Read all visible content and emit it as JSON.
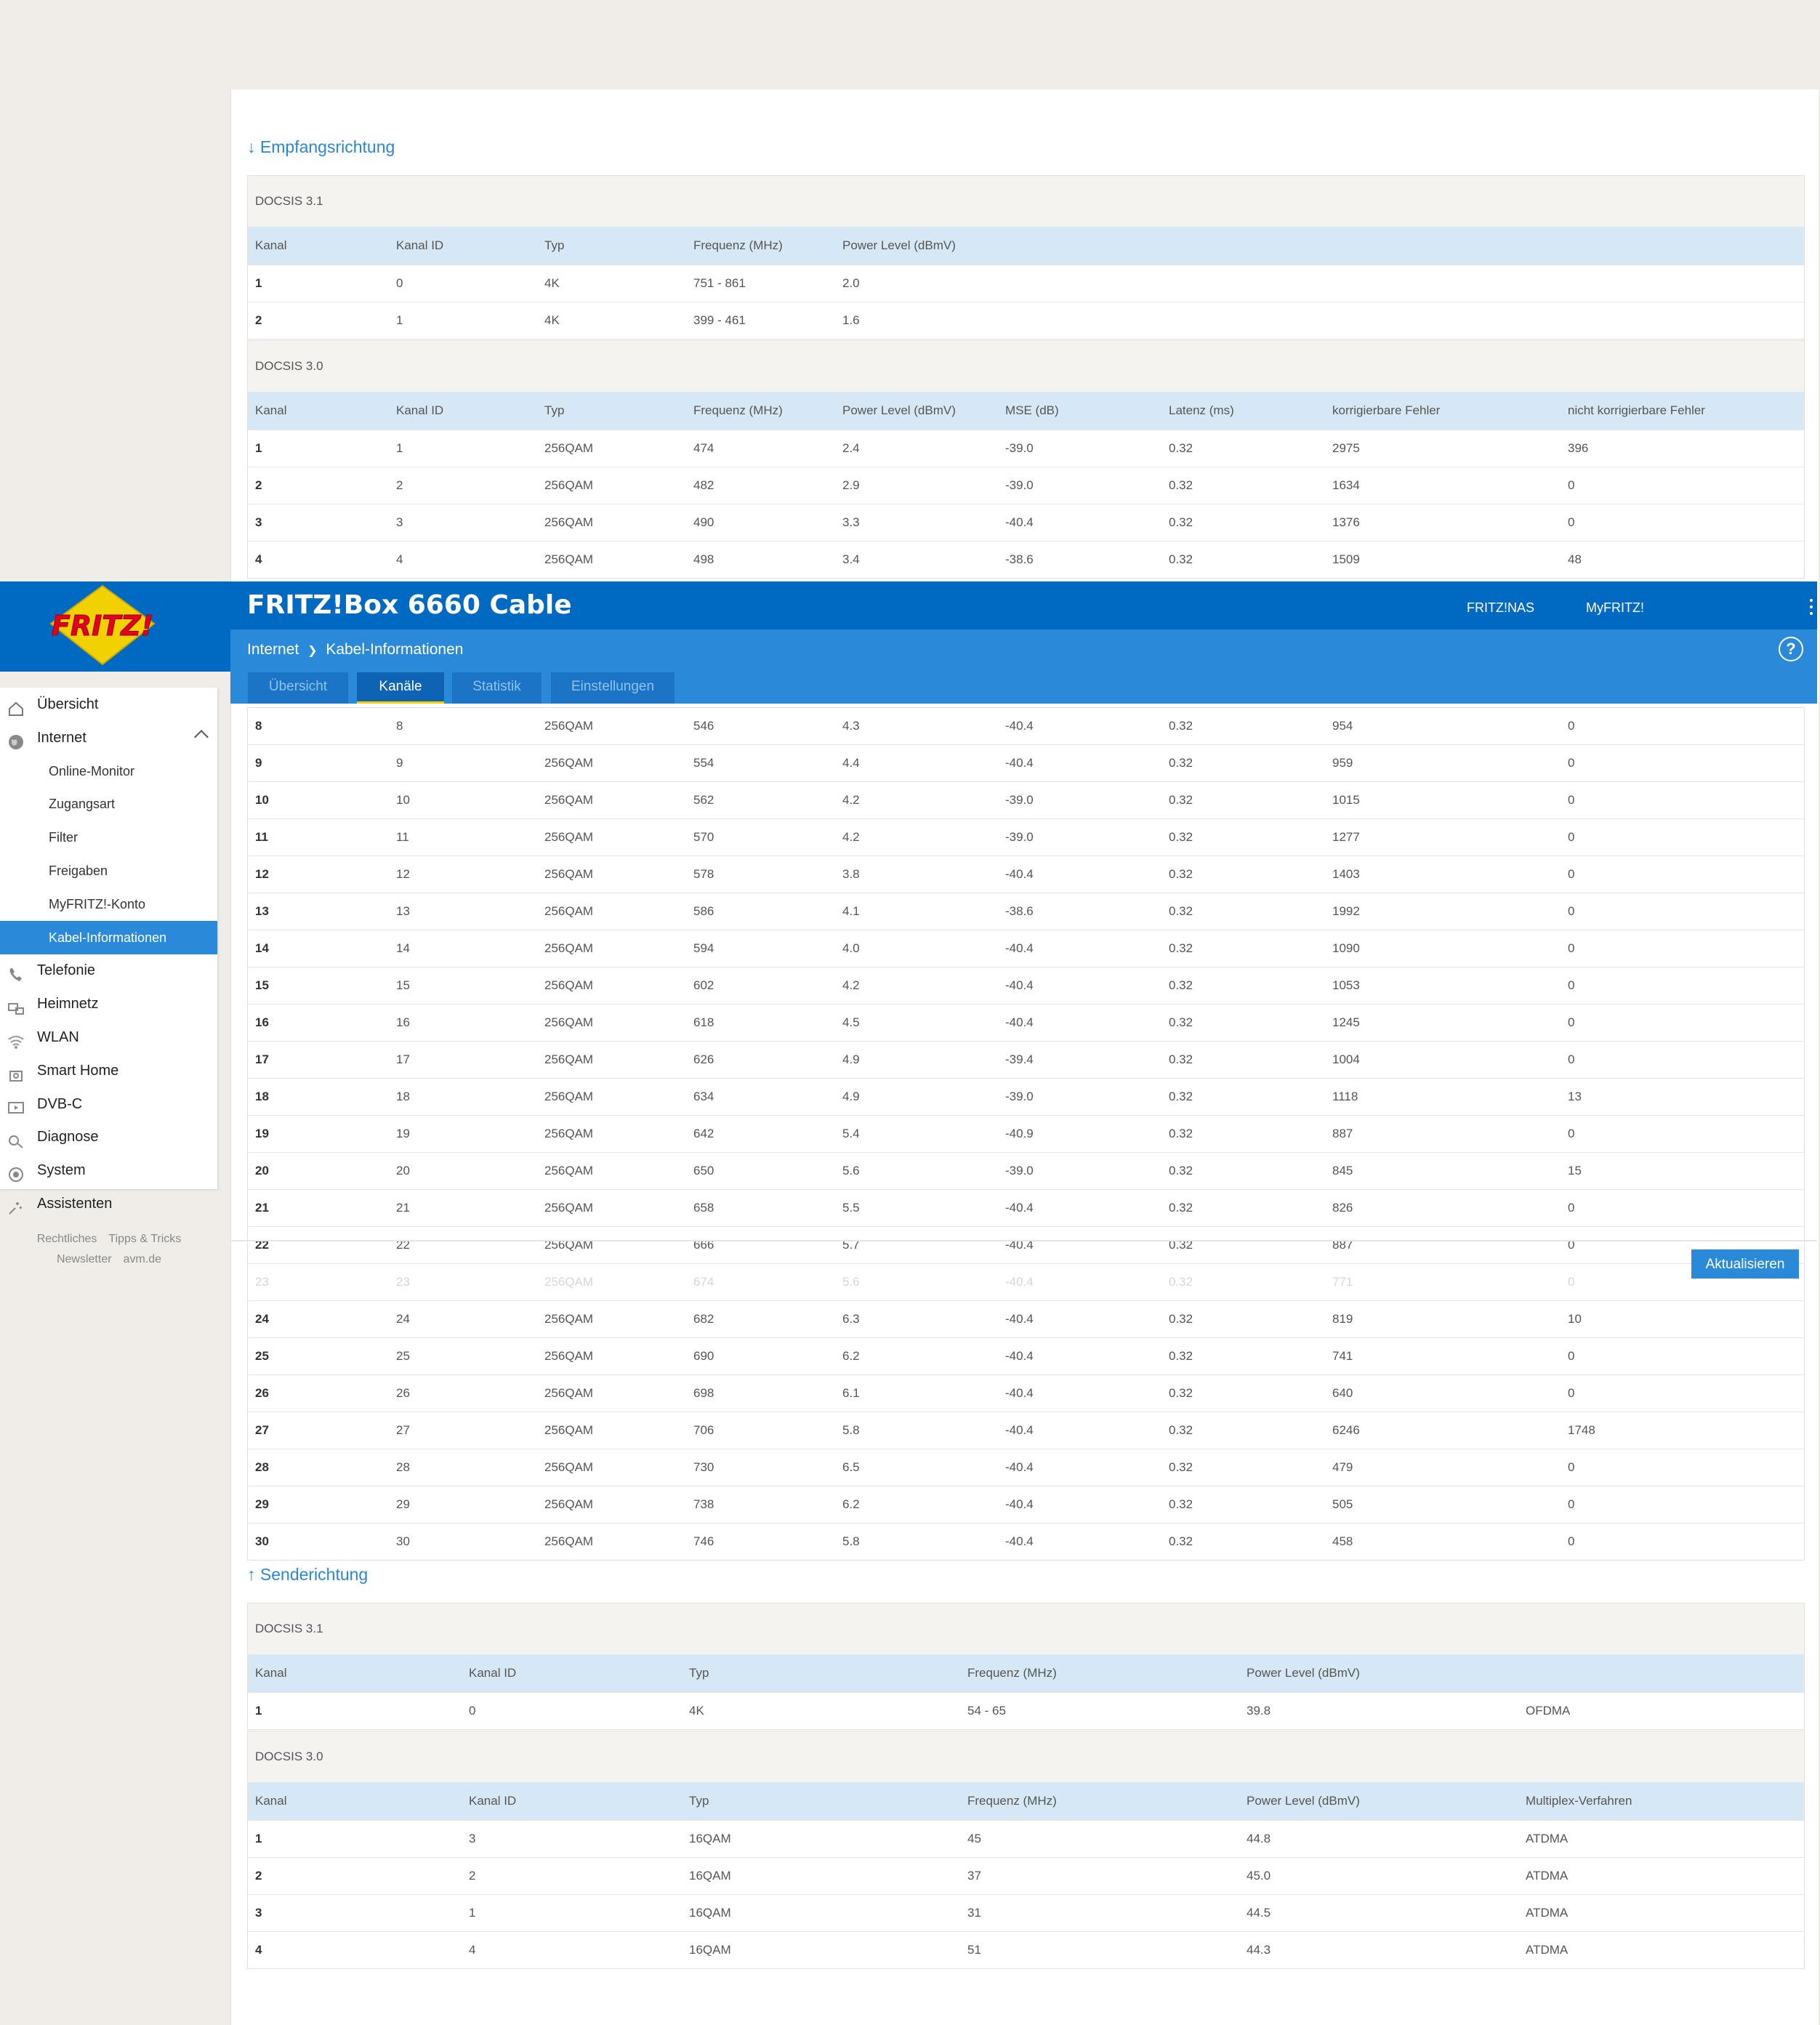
{
  "app": {
    "title": "FRITZ!Box 6660 Cable",
    "links": [
      "FRITZ!NAS",
      "MyFRITZ!"
    ],
    "logo_text": "FRITZ!"
  },
  "breadcrumb": {
    "parent": "Internet",
    "separator": "❯",
    "current": "Kabel-Informationen"
  },
  "help_label": "?",
  "tabs": [
    "Übersicht",
    "Kanäle",
    "Statistik",
    "Einstellungen"
  ],
  "active_tab": "Kanäle",
  "sidebar": {
    "items": [
      {
        "label": "Übersicht",
        "icon": "home-icon"
      },
      {
        "label": "Internet",
        "icon": "globe-icon",
        "expanded": true
      },
      {
        "label": "Online-Monitor",
        "sub": true
      },
      {
        "label": "Zugangsart",
        "sub": true
      },
      {
        "label": "Filter",
        "sub": true
      },
      {
        "label": "Freigaben",
        "sub": true
      },
      {
        "label": "MyFRITZ!-Konto",
        "sub": true
      },
      {
        "label": "Kabel-Informationen",
        "sub": true,
        "active": true
      },
      {
        "label": "Telefonie",
        "icon": "phone-icon"
      },
      {
        "label": "Heimnetz",
        "icon": "network-icon"
      },
      {
        "label": "WLAN",
        "icon": "wifi-icon"
      },
      {
        "label": "Smart Home",
        "icon": "smarthome-icon"
      },
      {
        "label": "DVB-C",
        "icon": "tv-icon"
      },
      {
        "label": "Diagnose",
        "icon": "diagnose-icon"
      },
      {
        "label": "System",
        "icon": "system-icon"
      },
      {
        "label": "Assistenten",
        "icon": "wizard-icon"
      }
    ],
    "footer_links": [
      [
        "Rechtliches",
        "Tipps & Tricks"
      ],
      [
        "Newsletter",
        "avm.de"
      ]
    ]
  },
  "refresh_label": "Aktualisieren",
  "downstream": {
    "title": "↓ Empfangsrichtung",
    "docsis31": {
      "label": "DOCSIS 3.1",
      "columns": [
        "Kanal",
        "Kanal ID",
        "Typ",
        "Frequenz (MHz)",
        "Power Level (dBmV)"
      ],
      "rows": [
        [
          "1",
          "0",
          "4K",
          "751 - 861",
          "2.0"
        ],
        [
          "2",
          "1",
          "4K",
          "399 - 461",
          "1.6"
        ]
      ]
    },
    "docsis30": {
      "label": "DOCSIS 3.0",
      "columns": [
        "Kanal",
        "Kanal ID",
        "Typ",
        "Frequenz (MHz)",
        "Power Level (dBmV)",
        "MSE (dB)",
        "Latenz (ms)",
        "korrigierbare Fehler",
        "nicht korrigierbare Fehler"
      ],
      "rows_top": [
        [
          "1",
          "1",
          "256QAM",
          "474",
          "2.4",
          "-39.0",
          "0.32",
          "2975",
          "396"
        ],
        [
          "2",
          "2",
          "256QAM",
          "482",
          "2.9",
          "-39.0",
          "0.32",
          "1634",
          "0"
        ],
        [
          "3",
          "3",
          "256QAM",
          "490",
          "3.3",
          "-40.4",
          "0.32",
          "1376",
          "0"
        ],
        [
          "4",
          "4",
          "256QAM",
          "498",
          "3.4",
          "-38.6",
          "0.32",
          "1509",
          "48"
        ]
      ],
      "rows_bottom": [
        [
          "8",
          "8",
          "256QAM",
          "546",
          "4.3",
          "-40.4",
          "0.32",
          "954",
          "0"
        ],
        [
          "9",
          "9",
          "256QAM",
          "554",
          "4.4",
          "-40.4",
          "0.32",
          "959",
          "0"
        ],
        [
          "10",
          "10",
          "256QAM",
          "562",
          "4.2",
          "-39.0",
          "0.32",
          "1015",
          "0"
        ],
        [
          "11",
          "11",
          "256QAM",
          "570",
          "4.2",
          "-39.0",
          "0.32",
          "1277",
          "0"
        ],
        [
          "12",
          "12",
          "256QAM",
          "578",
          "3.8",
          "-40.4",
          "0.32",
          "1403",
          "0"
        ],
        [
          "13",
          "13",
          "256QAM",
          "586",
          "4.1",
          "-38.6",
          "0.32",
          "1992",
          "0"
        ],
        [
          "14",
          "14",
          "256QAM",
          "594",
          "4.0",
          "-40.4",
          "0.32",
          "1090",
          "0"
        ],
        [
          "15",
          "15",
          "256QAM",
          "602",
          "4.2",
          "-40.4",
          "0.32",
          "1053",
          "0"
        ],
        [
          "16",
          "16",
          "256QAM",
          "618",
          "4.5",
          "-40.4",
          "0.32",
          "1245",
          "0"
        ],
        [
          "17",
          "17",
          "256QAM",
          "626",
          "4.9",
          "-39.4",
          "0.32",
          "1004",
          "0"
        ],
        [
          "18",
          "18",
          "256QAM",
          "634",
          "4.9",
          "-39.0",
          "0.32",
          "1118",
          "13"
        ],
        [
          "19",
          "19",
          "256QAM",
          "642",
          "5.4",
          "-40.9",
          "0.32",
          "887",
          "0"
        ],
        [
          "20",
          "20",
          "256QAM",
          "650",
          "5.6",
          "-39.0",
          "0.32",
          "845",
          "15"
        ],
        [
          "21",
          "21",
          "256QAM",
          "658",
          "5.5",
          "-40.4",
          "0.32",
          "826",
          "0"
        ],
        [
          "22",
          "22",
          "256QAM",
          "666",
          "5.7",
          "-40.4",
          "0.32",
          "887",
          "0"
        ],
        [
          "23",
          "23",
          "256QAM",
          "674",
          "5.6",
          "-40.4",
          "0.32",
          "771",
          "0"
        ],
        [
          "24",
          "24",
          "256QAM",
          "682",
          "6.3",
          "-40.4",
          "0.32",
          "819",
          "10"
        ],
        [
          "25",
          "25",
          "256QAM",
          "690",
          "6.2",
          "-40.4",
          "0.32",
          "741",
          "0"
        ],
        [
          "26",
          "26",
          "256QAM",
          "698",
          "6.1",
          "-40.4",
          "0.32",
          "640",
          "0"
        ],
        [
          "27",
          "27",
          "256QAM",
          "706",
          "5.8",
          "-40.4",
          "0.32",
          "6246",
          "1748"
        ],
        [
          "28",
          "28",
          "256QAM",
          "730",
          "6.5",
          "-40.4",
          "0.32",
          "479",
          "0"
        ],
        [
          "29",
          "29",
          "256QAM",
          "738",
          "6.2",
          "-40.4",
          "0.32",
          "505",
          "0"
        ],
        [
          "30",
          "30",
          "256QAM",
          "746",
          "5.8",
          "-40.4",
          "0.32",
          "458",
          "0"
        ]
      ]
    }
  },
  "upstream": {
    "title": "↑ Senderichtung",
    "docsis31": {
      "label": "DOCSIS 3.1",
      "columns": [
        "Kanal",
        "Kanal ID",
        "Typ",
        "Frequenz (MHz)",
        "Power Level (dBmV)",
        ""
      ],
      "rows": [
        [
          "1",
          "0",
          "4K",
          "54 - 65",
          "39.8",
          "OFDMA"
        ]
      ]
    },
    "docsis30": {
      "label": "DOCSIS 3.0",
      "columns": [
        "Kanal",
        "Kanal ID",
        "Typ",
        "Frequenz (MHz)",
        "Power Level (dBmV)",
        "Multiplex-Verfahren"
      ],
      "rows": [
        [
          "1",
          "3",
          "16QAM",
          "45",
          "44.8",
          "ATDMA"
        ],
        [
          "2",
          "2",
          "16QAM",
          "37",
          "45.0",
          "ATDMA"
        ],
        [
          "3",
          "1",
          "16QAM",
          "31",
          "44.5",
          "ATDMA"
        ],
        [
          "4",
          "4",
          "16QAM",
          "51",
          "44.3",
          "ATDMA"
        ]
      ]
    }
  },
  "colors": {
    "header_dark": "#0069c1",
    "header_light": "#2a89d8",
    "table_header": "#d6e8f6",
    "accent_tab": "#f2d100"
  }
}
